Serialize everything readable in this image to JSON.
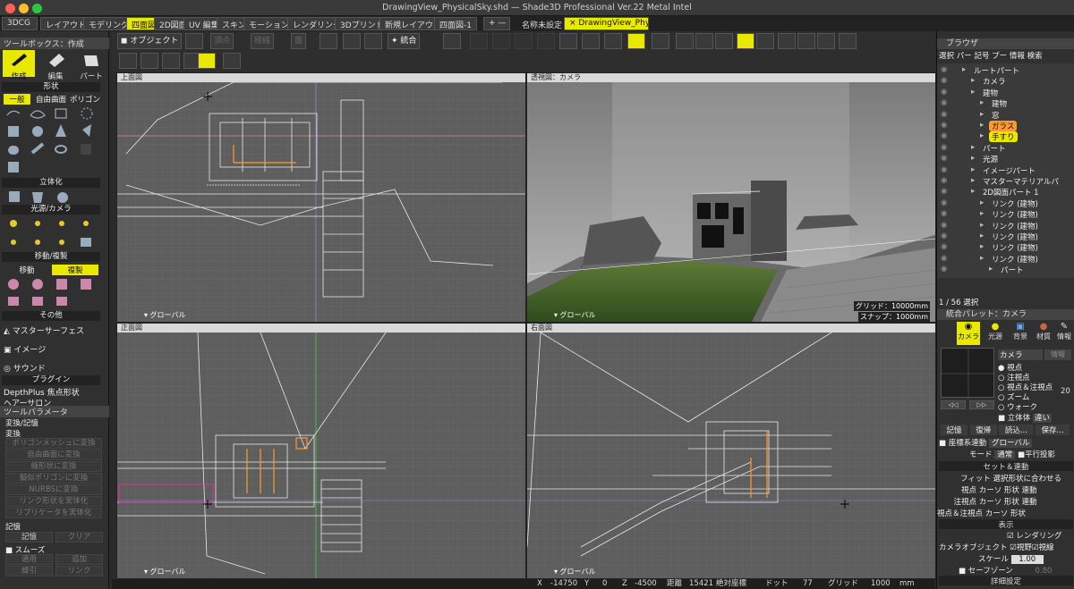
{
  "window": {
    "title": "DrawingView_PhysicalSky.shd — Shade3D Professional Ver.22 Metal Intel",
    "traffic_colors": [
      "#ff5f57",
      "#febc2e",
      "#28c840"
    ]
  },
  "tabs": {
    "app": "3DCG",
    "items": [
      "レイアウト",
      "モデリング",
      "四面図",
      "2D図面",
      "UV 編集",
      "スキン",
      "モーション",
      "レンダリング",
      "3Dプリント",
      "新規レイアウト",
      "四面図-1"
    ],
    "active_index": 2,
    "add": "+ —",
    "unnamed": "名称未設定",
    "drawing": "× DrawingView_PhysicalS..."
  },
  "toolbox": {
    "title": "ツールボックス：作成",
    "modes": [
      "作成",
      "編集",
      "パート"
    ],
    "shape_section": "形状",
    "shape_tabs": [
      "一般",
      "自由曲面",
      "ポリゴン"
    ],
    "solid_section": "立体化",
    "light_section": "光源/カメラ",
    "move_section": "移動/複製",
    "move_tabs": [
      "移動",
      "複製"
    ],
    "other_section": "その他",
    "other_items": [
      "マスターサーフェス",
      "イメージ",
      "サウンド"
    ],
    "plugin_section": "プラグイン",
    "plugin_items": [
      "DepthPlus 焦点形状",
      "ヘアーサロン"
    ]
  },
  "tool_params": {
    "title": "ツールパラメータ",
    "group": "変換/記憶",
    "convert_label": "変換",
    "convert_buttons": [
      "ポリゴンメッシュに変換",
      "自由曲面に変換",
      "線形状に変換",
      "擬似ポリゴンに変換",
      "NURBSに変換",
      "リンク形状を実体化",
      "リプリケータを実体化"
    ],
    "memory_label": "記憶",
    "memory_buttons": [
      "記憶",
      "クリア"
    ],
    "smooth_label": "スムーズ",
    "smooth_buttons": [
      "適用",
      "追加",
      "繰引",
      "リンク"
    ]
  },
  "toolbar": {
    "object": "オブジェクト",
    "vertex": "頂点",
    "edge": "稜線",
    "face": "面",
    "merge": "統合"
  },
  "viewports": {
    "top": {
      "label": "上面図",
      "footer": "▾ グローバル"
    },
    "perspective": {
      "label": "透視図：カメラ",
      "footer": "▾ グローバル",
      "grid": "グリッド：10000mm",
      "snap": "スナップ：1000mm"
    },
    "front": {
      "label": "正面図",
      "footer": "▾ グローバル"
    },
    "right": {
      "label": "右面図",
      "footer": "▾ グローバル"
    }
  },
  "browser": {
    "title": "ブラウザ",
    "tabs": [
      "選択",
      "パー",
      "記号",
      "プー",
      "情報",
      "検索"
    ],
    "tree": [
      {
        "label": "ルートパート",
        "indent": 0
      },
      {
        "label": "カメラ",
        "indent": 1
      },
      {
        "label": "建物",
        "indent": 1
      },
      {
        "label": "建物",
        "indent": 2
      },
      {
        "label": "窓",
        "indent": 2
      },
      {
        "label": "ガラス",
        "indent": 2,
        "highlight": "#ff9a2e"
      },
      {
        "label": "手すり",
        "indent": 2,
        "highlight": "#e8e800"
      },
      {
        "label": "パート",
        "indent": 1
      },
      {
        "label": "光源",
        "indent": 1
      },
      {
        "label": "イメージパート",
        "indent": 1
      },
      {
        "label": "マスターマテリアルパ",
        "indent": 1
      },
      {
        "label": "2D図面パート 1",
        "indent": 1
      },
      {
        "label": "リンク (建物)",
        "indent": 2
      },
      {
        "label": "リンク (建物)",
        "indent": 2
      },
      {
        "label": "リンク (建物)",
        "indent": 2
      },
      {
        "label": "リンク (建物)",
        "indent": 2
      },
      {
        "label": "リンク (建物)",
        "indent": 2
      },
      {
        "label": "リンク (建物)",
        "indent": 2
      },
      {
        "label": "パート",
        "indent": 3
      }
    ],
    "selection_count": "1 / 56 選択"
  },
  "palette": {
    "title": "統合パレット：カメラ",
    "tabs": [
      "カメラ",
      "光源",
      "背景",
      "材質",
      "情報"
    ],
    "camera_select": "カメラ",
    "camera_info": "情報",
    "radios": [
      "視点",
      "注視点",
      "視点＆注視点",
      "ズーム",
      "ウォーク"
    ],
    "radio_value": "20",
    "stereo": "立体体",
    "stereo_value": "違い",
    "actions": [
      "記憶",
      "復帰",
      "読込...",
      "保存..."
    ],
    "coord_link": "座標系連動",
    "coord_value": "グローバル",
    "mode_label": "モード",
    "mode_value": "通常",
    "parallel": "平行投影",
    "set_section": "セット＆連動",
    "fit_label": "フィット",
    "fit_value": "選択形状に合わせる",
    "rows": [
      {
        "label": "視点",
        "a": "カーソ",
        "b": "形状",
        "c": "連動"
      },
      {
        "label": "注視点",
        "a": "カーソ",
        "b": "形状",
        "c": "連動"
      },
      {
        "label": "視点＆注視点",
        "a": "カーソ",
        "b": "形状",
        "c": ""
      }
    ],
    "display_section": "表示",
    "rendering_check": "レンダリング",
    "camera_object": "カメラオブジェクト",
    "view_field": "視野",
    "view_line": "視線",
    "scale_label": "スケール",
    "scale_value": "1.00",
    "safe_zone": "セーフゾーン",
    "safe_value": "0.80",
    "detail_section": "詳細設定"
  },
  "status": {
    "x_label": "X",
    "x_value": "-14750",
    "y_label": "Y",
    "y_value": "0",
    "z_label": "Z",
    "z_value": "-4500",
    "dist_label": "距離",
    "dist_value": "15421",
    "abs_label": "絶対座標",
    "dot_label": "ドット",
    "dot_value": "77",
    "grid_label": "グリッド",
    "grid_value": "1000",
    "unit": "mm"
  }
}
